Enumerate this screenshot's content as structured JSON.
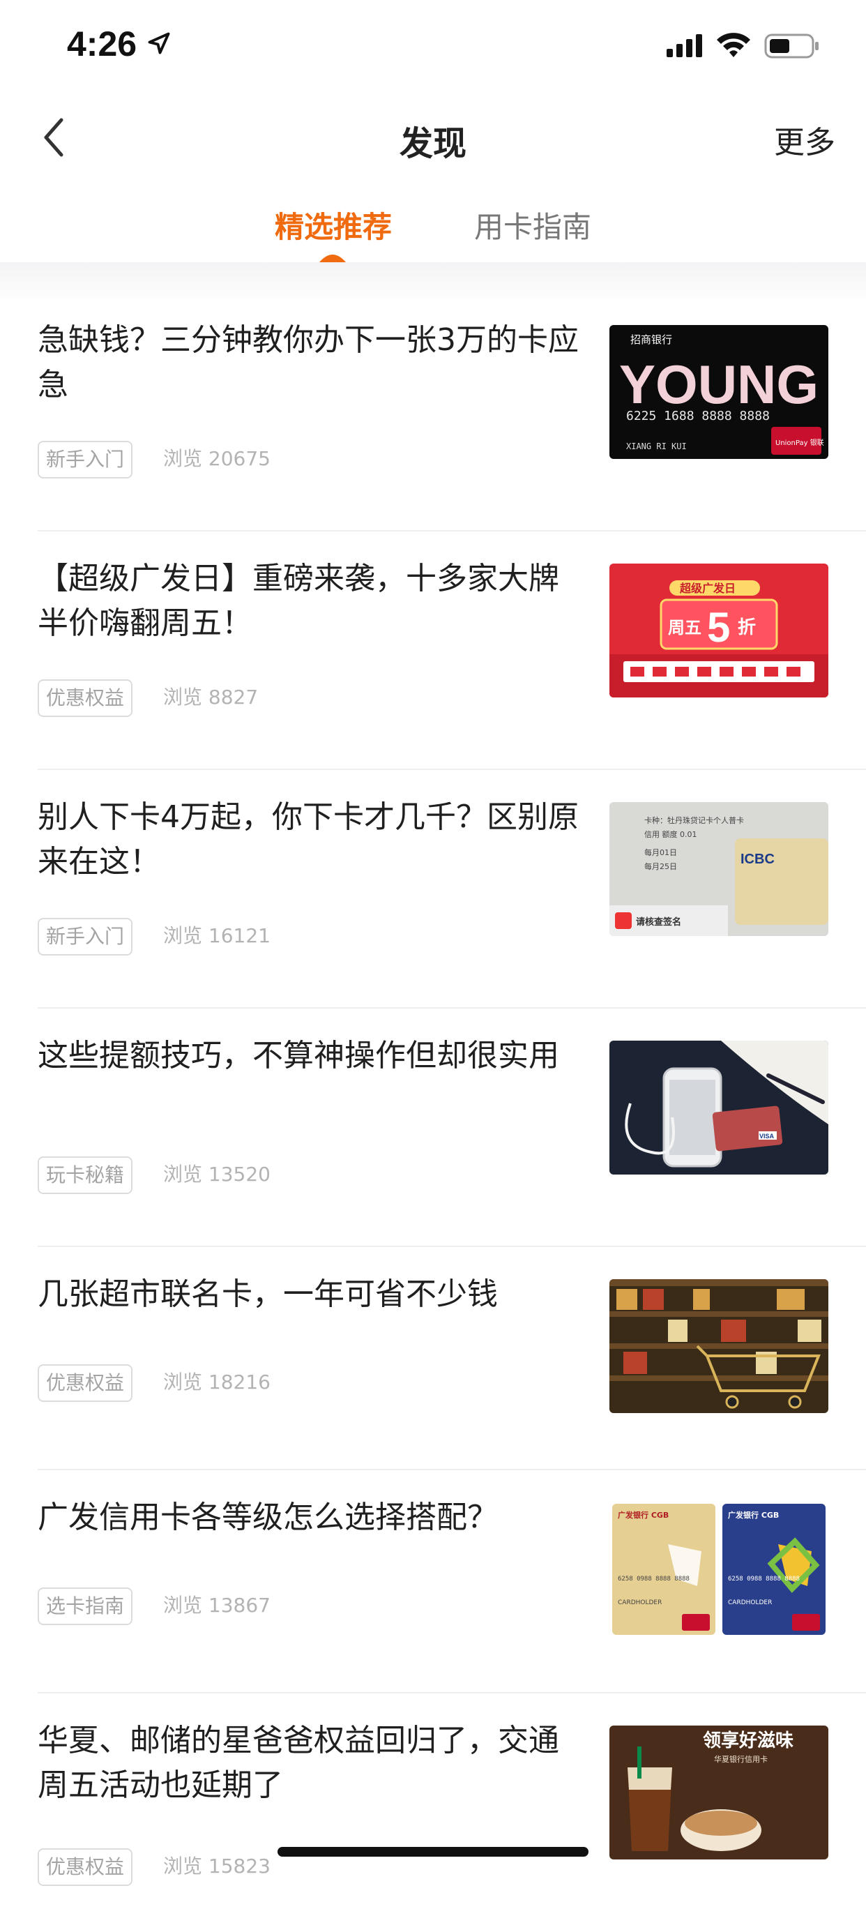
{
  "status": {
    "time": "4:26"
  },
  "nav": {
    "title": "发现",
    "more": "更多"
  },
  "tabs": [
    {
      "label": "精选推荐"
    },
    {
      "label": "用卡指南"
    }
  ],
  "articles": [
    {
      "title": "急缺钱？三分钟教你办下一张3万的卡应急",
      "tag": "新手入门",
      "views": "浏览 20675",
      "thumb": {
        "bank": "招商银行",
        "big": "YOUNG",
        "number": "6225 1688 8888 8888",
        "name": "XIANG RI KUI",
        "badge": "UnionPay 银联"
      }
    },
    {
      "title": "【超级广发日】重磅来袭，十多家大牌半价嗨翻周五！",
      "tag": "优惠权益",
      "views": "浏览 8827",
      "thumb": {
        "banner": "超级广发日",
        "day": "周五",
        "num": "5",
        "unit": "折"
      }
    },
    {
      "title": "别人下卡4万起，你下卡才几千？区别原来在这！",
      "tag": "新手入门",
      "views": "浏览 16121",
      "thumb": {
        "line1": "卡种：牡丹珠贷记卡个人普卡",
        "line2": "信用 额度 0.01",
        "line3": "每月01日",
        "line4": "每月25日",
        "bank": "ICBC",
        "stamp": "请核查签名"
      }
    },
    {
      "title": "这些提额技巧，不算神操作但却很实用",
      "tag": "玩卡秘籍",
      "views": "浏览 13520",
      "thumb": {
        "badge": "VISA"
      }
    },
    {
      "title": "几张超市联名卡，一年可省不少钱",
      "tag": "优惠权益",
      "views": "浏览 18216",
      "thumb": {}
    },
    {
      "title": "广发信用卡各等级怎么选择搭配？",
      "tag": "选卡指南",
      "views": "浏览 13867",
      "thumb": {
        "bank": "广发银行 CGB",
        "number": "6258 0988 8888 8888",
        "holder": "CARDHOLDER"
      }
    },
    {
      "title": "华夏、邮储的星爸爸权益回归了，交通周五活动也延期了",
      "tag": "优惠权益",
      "views": "浏览 15823",
      "thumb": {
        "headline": "领享好滋味",
        "sub": "华夏银行信用卡"
      }
    }
  ]
}
